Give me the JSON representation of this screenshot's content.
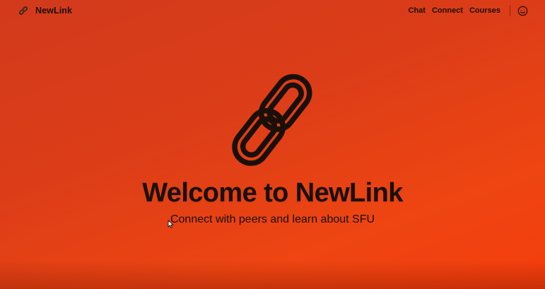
{
  "navbar": {
    "brand": {
      "icon": "link-icon",
      "name": "NewLink"
    },
    "links": [
      {
        "label": "Chat"
      },
      {
        "label": "Connect"
      },
      {
        "label": "Courses"
      }
    ],
    "profile_icon": "smiley-face-icon"
  },
  "hero": {
    "logo_icon": "chain-link-icon",
    "title": "Welcome to NewLink",
    "subtitle": "Connect with peers and learn about SFU"
  },
  "colors": {
    "background_start": "#d23a1c",
    "background_end": "#f43d0c",
    "text": "#1a1008"
  }
}
